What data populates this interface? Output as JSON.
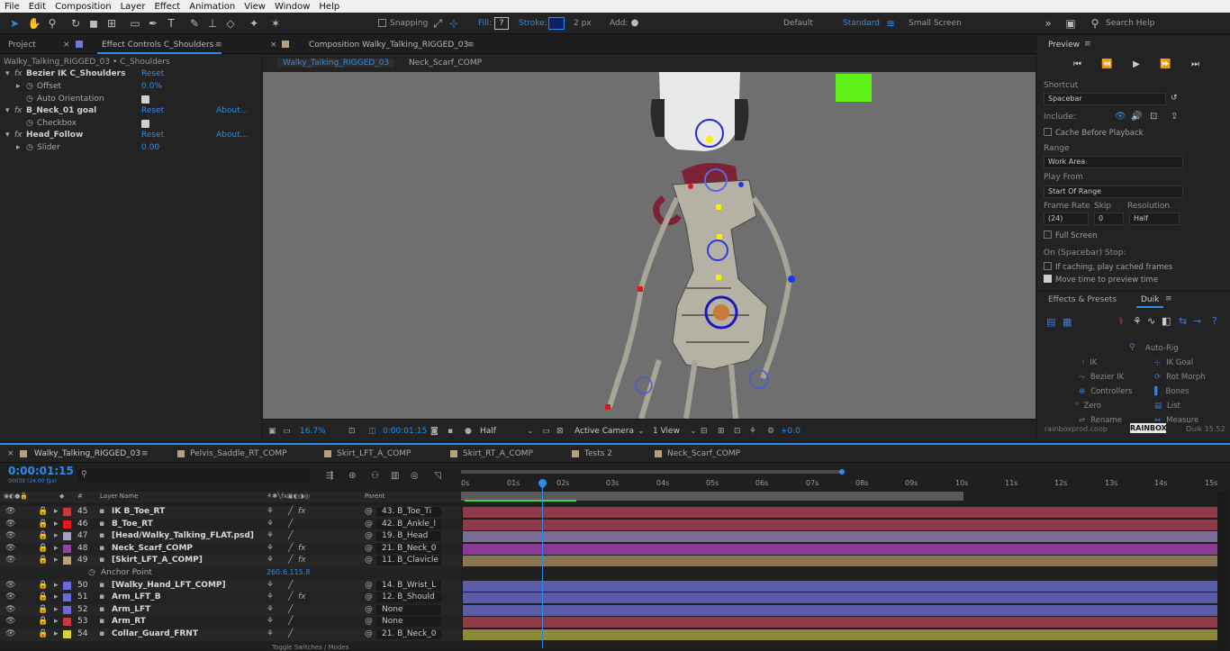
{
  "menu": [
    "File",
    "Edit",
    "Composition",
    "Layer",
    "Effect",
    "Animation",
    "View",
    "Window",
    "Help"
  ],
  "toolbar": {
    "snapping": "Snapping",
    "fill": "Fill:",
    "fill_value": "?",
    "stroke": "Stroke:",
    "stroke_px": "2 px",
    "add": "Add:",
    "workspaces": [
      "Default",
      "Standard",
      "Small Screen"
    ],
    "search": "Search Help"
  },
  "left_panel": {
    "tab_project": "Project",
    "tab_effect_controls": "Effect Controls C_Shoulders",
    "breadcrumb": "Walky_Talking_RIGGED_03 • C_Shoulders",
    "effects": [
      {
        "name": "Bezier IK C_Shoulders",
        "reset": "Reset",
        "about": ""
      },
      {
        "name": "Offset",
        "value": "0.0%"
      },
      {
        "name": "Auto Orientation",
        "value": ""
      },
      {
        "name": "B_Neck_01 goal",
        "reset": "Reset",
        "about": "About..."
      },
      {
        "name": "Checkbox",
        "value": ""
      },
      {
        "name": "Head_Follow",
        "reset": "Reset",
        "about": "About..."
      },
      {
        "name": "Slider",
        "value": "0.00"
      }
    ]
  },
  "comp_panel": {
    "tab": "Composition Walky_Talking_RIGGED_03",
    "subtabs": [
      "Walky_Talking_RIGGED_03",
      "Neck_Scarf_COMP"
    ],
    "zoom": "16.7%",
    "timecode": "0:00:01:15",
    "resolution": "Half",
    "camera": "Active Camera",
    "views": "1 View",
    "exposure": "+0.0"
  },
  "preview": {
    "title": "Preview",
    "shortcut_label": "Shortcut",
    "shortcut": "Spacebar",
    "include": "Include:",
    "cache": "Cache Before Playback",
    "range_label": "Range",
    "range": "Work Area",
    "play_from_label": "Play From",
    "play_from": "Start Of Range",
    "frame_rate_label": "Frame Rate",
    "skip_label": "Skip",
    "resolution_label": "Resolution",
    "frame_rate": "(24)",
    "skip": "0",
    "resolution": "Half",
    "full_screen": "Full Screen",
    "stop_label": "On (Spacebar) Stop:",
    "if_caching": "If caching, play cached frames",
    "move_time": "Move time to preview time"
  },
  "effects_presets": {
    "tab1": "Effects & Presets",
    "tab2": "Duik",
    "auto_rig": "Auto-Rig",
    "items": [
      [
        "IK",
        "IK Goal"
      ],
      [
        "Bezier IK",
        "Rot Morph"
      ],
      [
        "Controllers",
        "Bones"
      ],
      [
        "Zero",
        "List"
      ],
      [
        "Rename",
        "Measure"
      ]
    ],
    "footer": "rainboxprod.coop",
    "version": "Duik 15.52"
  },
  "timeline": {
    "tabs": [
      "Walky_Talking_RIGGED_03",
      "Pelvis_Saddle_RT_COMP",
      "Skirt_LFT_A_COMP",
      "Skirt_RT_A_COMP",
      "Tests 2",
      "Neck_Scarf_COMP"
    ],
    "timecode": "0:00:01:15",
    "fps": "00039 (24.00 fps)",
    "col_layer_name": "Layer Name",
    "col_parent": "Parent",
    "ruler": [
      "0s",
      "01s",
      "02s",
      "03s",
      "04s",
      "05s",
      "06s",
      "07s",
      "08s",
      "09s",
      "10s",
      "11s",
      "12s",
      "13s",
      "14s",
      "15s"
    ],
    "layers": [
      {
        "num": "45",
        "name": "IK B_Toe_RT",
        "color": "#c33b3b",
        "parent": "43. B_Toe_Ti",
        "fx": "fx",
        "bar": "#8e3a48"
      },
      {
        "num": "46",
        "name": "B_Toe_RT",
        "color": "#e01818",
        "parent": "42. B_Ankle_l",
        "fx": "",
        "bar": "#8e3a48"
      },
      {
        "num": "47",
        "name": "[Head/Walky_Talking_FLAT.psd]",
        "color": "#a89fc8",
        "parent": "19. B_Head",
        "fx": "",
        "bar": "#7a6d98"
      },
      {
        "num": "48",
        "name": "Neck_Scarf_COMP",
        "color": "#9b3fa8",
        "parent": "21. B_Neck_0",
        "fx": "fx",
        "bar": "#8a3a90"
      },
      {
        "num": "49",
        "name": "[Skirt_LFT_A_COMP]",
        "color": "#b5a27a",
        "parent": "11. B_Clavicle",
        "fx": "fx",
        "bar": "#887654"
      },
      {
        "num": "",
        "name": "Anchor Point",
        "color": "",
        "parent": "",
        "fx": "",
        "value": "260.6,115.8",
        "bar": ""
      },
      {
        "num": "50",
        "name": "[Walky_Hand_LFT_COMP]",
        "color": "#6a6ad8",
        "parent": "14. B_Wrist_L",
        "fx": "",
        "bar": "#5a5ca8"
      },
      {
        "num": "51",
        "name": "Arm_LFT_B",
        "color": "#6a6ad8",
        "parent": "12. B_Should",
        "fx": "fx",
        "bar": "#5a5ca8"
      },
      {
        "num": "52",
        "name": "Arm_LFT",
        "color": "#6a6ad8",
        "parent": "None",
        "fx": "",
        "bar": "#5a5ca8"
      },
      {
        "num": "53",
        "name": "Arm_RT",
        "color": "#c33b3b",
        "parent": "None",
        "fx": "",
        "bar": "#8e3a48"
      },
      {
        "num": "54",
        "name": "Collar_Guard_FRNT",
        "color": "#d8d040",
        "parent": "21. B_Neck_0",
        "fx": "",
        "bar": "#8c8a3a"
      }
    ],
    "footer": "Toggle Switches / Modes"
  }
}
